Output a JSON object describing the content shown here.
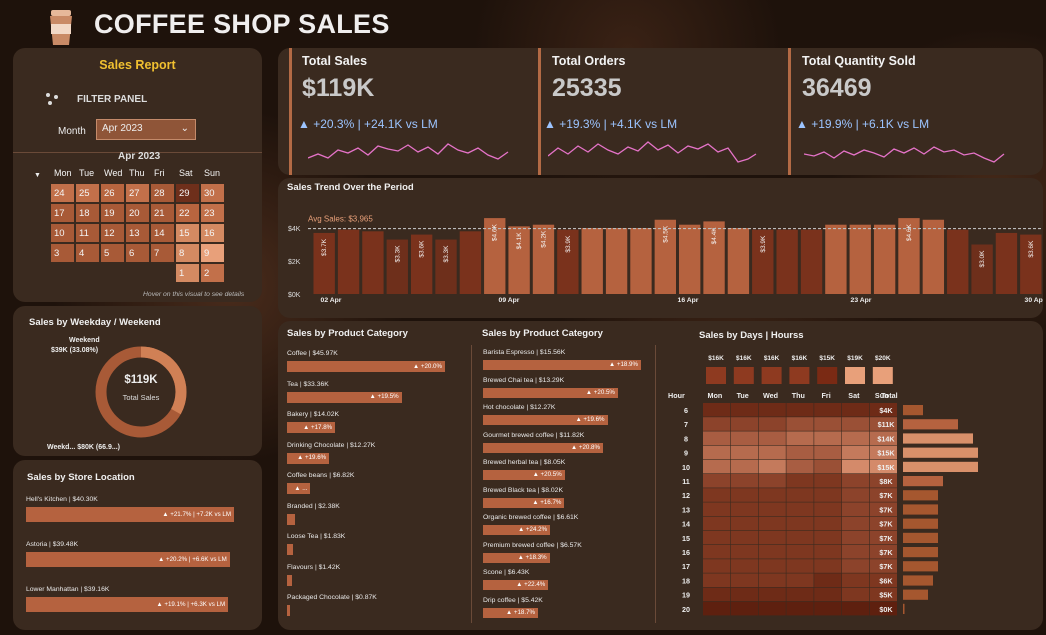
{
  "app": {
    "title": "COFFEE SHOP SALES"
  },
  "filter": {
    "heading": "Sales Report",
    "panel_label": "FILTER PANEL",
    "month_label": "Month",
    "month_value": "Apr 2023",
    "hint": "Hover on this visual to see details"
  },
  "calendar": {
    "title": "Apr 2023",
    "weekdays": [
      "Mon",
      "Tue",
      "Wed",
      "Thu",
      "Fri",
      "Sat",
      "Sun"
    ],
    "rows": [
      [
        "24",
        "25",
        "26",
        "27",
        "28",
        "29",
        "30"
      ],
      [
        "17",
        "18",
        "19",
        "20",
        "21",
        "22",
        "23"
      ],
      [
        "10",
        "11",
        "12",
        "13",
        "14",
        "15",
        "16"
      ],
      [
        "3",
        "4",
        "5",
        "6",
        "7",
        "8",
        "9"
      ],
      [
        "",
        "",
        "",
        "",
        "",
        "1",
        "2"
      ]
    ]
  },
  "kpis": [
    {
      "title": "Total Sales",
      "value": "$119K",
      "delta": "+20.3% | +24.1K vs LM"
    },
    {
      "title": "Total Orders",
      "value": "25335",
      "delta": "+19.3% | +4.1K vs LM"
    },
    {
      "title": "Total Quantity Sold",
      "value": "36469",
      "delta": "+19.9% | +6.1K vs LM"
    }
  ],
  "trend": {
    "title": "Sales Trend Over the Period",
    "avg_label": "Avg Sales: $3,965",
    "avg": 3.965,
    "y_ticks": [
      "$4K",
      "$2K",
      "$0K"
    ],
    "x_ticks": [
      "02 Apr",
      "09 Apr",
      "16 Apr",
      "23 Apr",
      "30 Apr"
    ],
    "values": [
      3.7,
      3.9,
      3.8,
      3.3,
      3.6,
      3.3,
      3.8,
      4.6,
      4.1,
      4.2,
      3.9,
      4.0,
      4.0,
      4.0,
      4.5,
      4.2,
      4.4,
      4.0,
      3.9,
      3.9,
      3.9,
      4.2,
      4.2,
      4.2,
      4.6,
      4.5,
      3.9,
      3.0,
      3.7,
      3.6
    ],
    "labels": [
      "$3.7K",
      "",
      "",
      "$3.3K",
      "$3.6K",
      "$3.3K",
      "",
      "$4.6K",
      "$4.1K",
      "$4.2K",
      "$3.9K",
      "",
      "",
      "",
      "$4.5K",
      "",
      "$4.4K",
      "",
      "$3.9K",
      "",
      "",
      "",
      "",
      "",
      "$4.6K",
      "",
      "",
      "$3.0K",
      "",
      "$3.6K"
    ]
  },
  "weekday": {
    "title": "Sales by Weekday / Weekend",
    "weekend_label": "Weekend",
    "weekend_value": "$39K (33.08%)",
    "weekday_label": "Weekd... $80K (66.9...)",
    "center_value": "$119K",
    "center_label": "Total Sales",
    "weekend_share": 33.08
  },
  "store": {
    "title": "Sales by Store Location",
    "items": [
      {
        "label": "Hell's Kitchen | $40.30K",
        "delta": "▲ +21.7% | +7.2K vs LM",
        "value": 40.3
      },
      {
        "label": "Astoria | $39.48K",
        "delta": "▲ +20.2% | +6.6K vs LM",
        "value": 39.48
      },
      {
        "label": "Lower Manhattan | $39.16K",
        "delta": "▲ +19.1% | +6.3K vs LM",
        "value": 39.16
      }
    ]
  },
  "category": {
    "title": "Sales by Product Category",
    "items": [
      {
        "label": "Coffee | $45.97K",
        "delta": "▲ +20.0%",
        "value": 45.97
      },
      {
        "label": "Tea | $33.36K",
        "delta": "▲ +19.5%",
        "value": 33.36
      },
      {
        "label": "Bakery | $14.02K",
        "delta": "▲ +17.8%",
        "value": 14.02
      },
      {
        "label": "Drinking Chocolate | $12.27K",
        "delta": "▲ +19.6%",
        "value": 12.27
      },
      {
        "label": "Coffee beans | $6.82K",
        "delta": "▲ ...",
        "value": 6.82
      },
      {
        "label": "Branded | $2.38K",
        "delta": "",
        "value": 2.38
      },
      {
        "label": "Loose Tea | $1.83K",
        "delta": "",
        "value": 1.83
      },
      {
        "label": "Flavours | $1.42K",
        "delta": "",
        "value": 1.42
      },
      {
        "label": "Packaged Chocolate | $0.87K",
        "delta": "",
        "value": 0.87
      }
    ]
  },
  "product": {
    "title": "Sales by Product Category",
    "items": [
      {
        "label": "Barista Espresso | $15.56K",
        "delta": "▲ +18.9%",
        "value": 15.56
      },
      {
        "label": "Brewed Chai tea | $13.29K",
        "delta": "▲ +20.5%",
        "value": 13.29
      },
      {
        "label": "Hot chocolate | $12.27K",
        "delta": "▲ +19.6%",
        "value": 12.27
      },
      {
        "label": "Gourmet brewed coffee | $11.82K",
        "delta": "▲ +20.8%",
        "value": 11.82
      },
      {
        "label": "Brewed herbal tea | $8.05K",
        "delta": "▲ +20.5%",
        "value": 8.05
      },
      {
        "label": "Brewed Black tea | $8.02K",
        "delta": "▲ +16.7%",
        "value": 8.02
      },
      {
        "label": "Organic brewed coffee | $6.61K",
        "delta": "▲ +24.2%",
        "value": 6.61
      },
      {
        "label": "Premium brewed coffee | $6.57K",
        "delta": "▲ +18.3%",
        "value": 6.57
      },
      {
        "label": "Scone | $6.43K",
        "delta": "▲ +22.4%",
        "value": 6.43
      },
      {
        "label": "Drip coffee | $5.42K",
        "delta": "▲ +18.7%",
        "value": 5.42
      }
    ]
  },
  "heatmap": {
    "title": "Sales by Days | Hourss",
    "day_totals": [
      "$16K",
      "$16K",
      "$16K",
      "$16K",
      "$15K",
      "$19K",
      "$20K"
    ],
    "days": [
      "Mon",
      "Tue",
      "Wed",
      "Thu",
      "Fri",
      "Sat",
      "Sun"
    ],
    "hour_label": "Hour",
    "total_label": "Total",
    "hours": [
      "6",
      "7",
      "8",
      "9",
      "10",
      "11",
      "12",
      "13",
      "14",
      "15",
      "16",
      "17",
      "18",
      "19",
      "20"
    ],
    "hour_totals": [
      "$4K",
      "$11K",
      "$14K",
      "$15K",
      "$15K",
      "$8K",
      "$7K",
      "$7K",
      "$7K",
      "$7K",
      "$7K",
      "$7K",
      "$6K",
      "$5K",
      "$0K"
    ],
    "hour_values": [
      4,
      11,
      14,
      15,
      15,
      8,
      7,
      7,
      7,
      7,
      7,
      7,
      6,
      5,
      0.3
    ],
    "cells": [
      [
        2,
        2,
        2,
        2,
        2,
        2,
        2
      ],
      [
        4,
        4,
        4,
        5,
        5,
        5,
        5
      ],
      [
        6,
        6,
        6,
        7,
        7,
        7,
        7
      ],
      [
        7,
        7,
        7,
        6,
        6,
        8,
        8
      ],
      [
        7,
        7,
        8,
        6,
        5,
        9,
        9
      ],
      [
        4,
        4,
        4,
        3,
        3,
        4,
        4
      ],
      [
        3,
        3,
        3,
        3,
        3,
        4,
        4
      ],
      [
        3,
        3,
        3,
        3,
        3,
        4,
        4
      ],
      [
        3,
        3,
        3,
        3,
        3,
        4,
        4
      ],
      [
        3,
        3,
        3,
        3,
        3,
        4,
        4
      ],
      [
        3,
        3,
        3,
        3,
        3,
        4,
        4
      ],
      [
        3,
        3,
        3,
        3,
        3,
        4,
        4
      ],
      [
        3,
        3,
        3,
        3,
        2,
        3,
        3
      ],
      [
        2,
        2,
        2,
        2,
        2,
        3,
        3
      ],
      [
        1,
        1,
        1,
        1,
        1,
        1,
        1
      ]
    ]
  },
  "colors": {
    "accent": "#b5623f",
    "panel": "#3a2a1f",
    "light": "#e8a07a",
    "dark": "#6b2b17",
    "blue": "#9cc4ff",
    "pink": "#e573c8"
  }
}
